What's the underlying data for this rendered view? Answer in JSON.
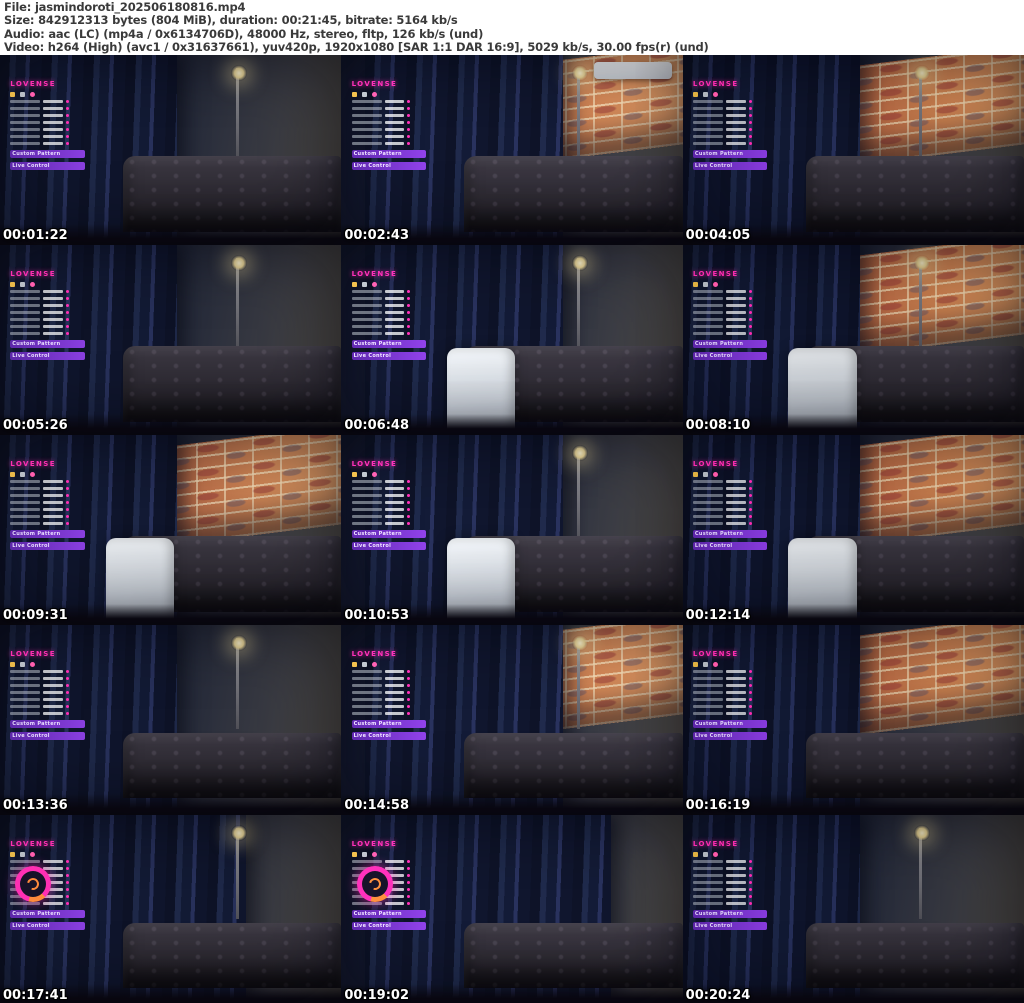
{
  "header": {
    "lines": [
      "File: jasmindoroti_202506180816.mp4",
      "Size: 842912313 bytes (804 MiB), duration: 00:21:45, bitrate: 5164 kb/s",
      "Audio: aac (LC) (mp4a / 0x6134706D), 48000 Hz, stereo, fltp, 126 kb/s (und)",
      "Video: h264 (High) (avc1 / 0x31637661), yuv420p, 1920x1080 [SAR 1:1 DAR 16:9], 5029 kb/s, 30.00 fps(r) (und)"
    ]
  },
  "grid": {
    "columns": 3,
    "rows": 5
  },
  "overlay": {
    "brand": "Lovense",
    "chips": [
      "Custom Pattern",
      "Live Control"
    ]
  },
  "colors": {
    "header_text": "#3a3a3a",
    "header_bg": "#ffffff",
    "timestamp_text": "#ffffff",
    "lovense_pink": "#ff2fb3",
    "chip_purple": "#6d2fbf",
    "brick": "#c5784a",
    "curtain_navy": "#161d36",
    "couch": "#2e2a35"
  },
  "thumbnails": [
    {
      "timestamp": "00:01:22",
      "brick": false,
      "lamp": true,
      "chair": false,
      "ring": false,
      "ac": false
    },
    {
      "timestamp": "00:02:43",
      "brick": true,
      "lamp": true,
      "chair": false,
      "ring": false,
      "ac": true
    },
    {
      "timestamp": "00:04:05",
      "brick": true,
      "lamp": true,
      "chair": false,
      "ring": false,
      "ac": false
    },
    {
      "timestamp": "00:05:26",
      "brick": false,
      "lamp": true,
      "chair": false,
      "ring": false,
      "ac": false
    },
    {
      "timestamp": "00:06:48",
      "brick": false,
      "lamp": true,
      "chair": true,
      "ring": false,
      "ac": false
    },
    {
      "timestamp": "00:08:10",
      "brick": true,
      "lamp": true,
      "chair": true,
      "ring": false,
      "ac": false
    },
    {
      "timestamp": "00:09:31",
      "brick": true,
      "lamp": false,
      "chair": true,
      "ring": false,
      "ac": false
    },
    {
      "timestamp": "00:10:53",
      "brick": false,
      "lamp": true,
      "chair": true,
      "ring": false,
      "ac": false
    },
    {
      "timestamp": "00:12:14",
      "brick": true,
      "lamp": false,
      "chair": true,
      "ring": false,
      "ac": false
    },
    {
      "timestamp": "00:13:36",
      "brick": false,
      "lamp": true,
      "chair": false,
      "ring": false,
      "ac": false
    },
    {
      "timestamp": "00:14:58",
      "brick": true,
      "lamp": true,
      "chair": false,
      "ring": false,
      "ac": false
    },
    {
      "timestamp": "00:16:19",
      "brick": true,
      "lamp": false,
      "chair": false,
      "ring": false,
      "ac": false
    },
    {
      "timestamp": "00:17:41",
      "brick": false,
      "lamp": true,
      "chair": false,
      "ring": true,
      "ac": false
    },
    {
      "timestamp": "00:19:02",
      "brick": false,
      "lamp": false,
      "chair": false,
      "ring": true,
      "ac": false
    },
    {
      "timestamp": "00:20:24",
      "brick": false,
      "lamp": true,
      "chair": false,
      "ring": false,
      "ac": false
    }
  ]
}
